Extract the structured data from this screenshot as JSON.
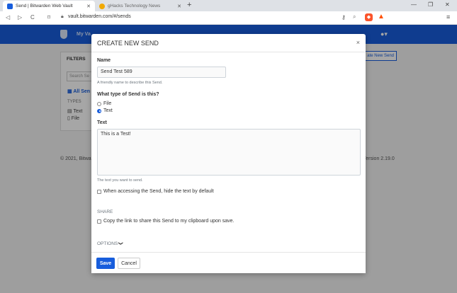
{
  "browser": {
    "tabs": [
      {
        "title": "Send | Bitwarden Web Vault",
        "active": true
      },
      {
        "title": "gHacks Technology News",
        "active": false
      }
    ],
    "url": "vault.bitwarden.com/#/sends"
  },
  "app": {
    "nav_partial": "My Va",
    "page_behind": {
      "filters_title": "FILTERS",
      "search_placeholder": "Search Se",
      "all_sends": "All Sen",
      "types_title": "TYPES",
      "type_text": "Text",
      "type_file": "File",
      "create_button": "ate New Send",
      "footer_left": "© 2021, Bitwa",
      "footer_right": "Version 2.19.0"
    }
  },
  "modal": {
    "title": "CREATE NEW SEND",
    "close": "×",
    "name_label": "Name",
    "name_value": "Send Test 589",
    "name_help": "A friendly name to describe this Send.",
    "type_label": "What type of Send is this?",
    "type_options": [
      {
        "label": "File",
        "selected": false
      },
      {
        "label": "Text",
        "selected": true
      }
    ],
    "text_label": "Text",
    "text_value": "This is a Test!",
    "text_help": "The text you want to send.",
    "hide_text_checkbox": "When accessing the Send, hide the text by default",
    "share_section": "SHARE",
    "copy_link_checkbox": "Copy the link to share this Send to my clipboard upon save.",
    "options_label": "OPTIONS",
    "save_button": "Save",
    "cancel_button": "Cancel"
  },
  "colors": {
    "brand": "#175ddc"
  }
}
